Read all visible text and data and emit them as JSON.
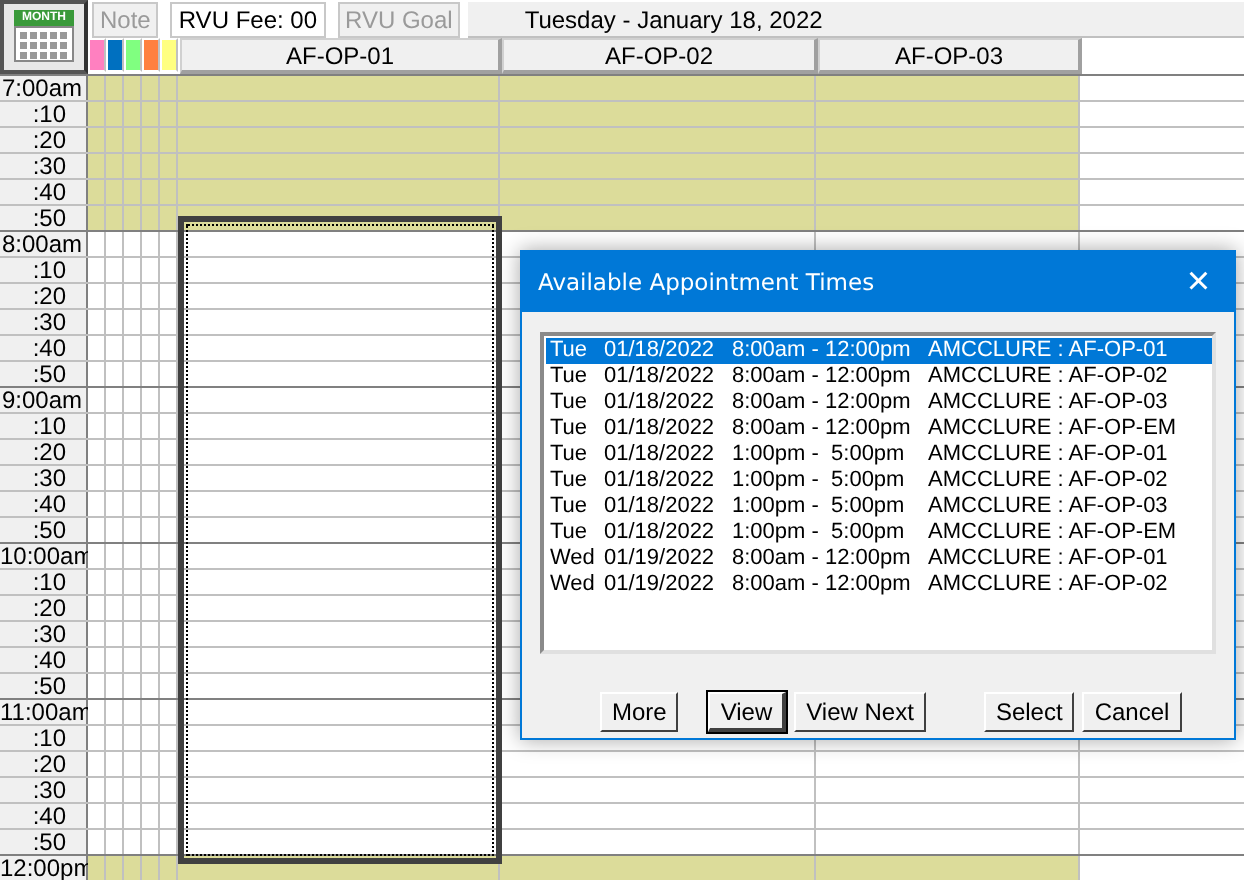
{
  "toolbar": {
    "month_button": "MONTH",
    "tabs": [
      {
        "label": "Note",
        "disabled": true
      },
      {
        "label": "RVU Fee: 00",
        "disabled": false
      },
      {
        "label": "RVU Goal",
        "disabled": true
      }
    ],
    "date_title": "Tuesday - January 18, 2022"
  },
  "swatches": [
    {
      "color": "#ff80c0"
    },
    {
      "color": "#0070c0"
    },
    {
      "color": "#80ff80"
    },
    {
      "color": "#ff8040"
    },
    {
      "color": "#ffff80"
    }
  ],
  "columns": [
    "AF-OP-01",
    "AF-OP-02",
    "AF-OP-03"
  ],
  "hours": [
    {
      "label": "7:00am",
      "highlighted": true,
      "minutes": [
        ":10",
        ":20",
        ":30",
        ":40",
        ":50"
      ]
    },
    {
      "label": "8:00am",
      "highlighted": false,
      "minutes": [
        ":10",
        ":20",
        ":30",
        ":40",
        ":50"
      ]
    },
    {
      "label": "9:00am",
      "highlighted": false,
      "minutes": [
        ":10",
        ":20",
        ":30",
        ":40",
        ":50"
      ]
    },
    {
      "label": "10:00am",
      "highlighted": false,
      "minutes": [
        ":10",
        ":20",
        ":30",
        ":40",
        ":50"
      ]
    },
    {
      "label": "11:00am",
      "highlighted": false,
      "minutes": [
        ":10",
        ":20",
        ":30",
        ":40",
        ":50"
      ]
    },
    {
      "label": "12:00pm",
      "highlighted": true
    }
  ],
  "dialog": {
    "title": "Available Appointment Times",
    "close": "×",
    "items": [
      {
        "day": "Tue",
        "date": "01/18/2022",
        "time": "8:00am - 12:00pm",
        "resource": "AMCCLURE : AF-OP-01",
        "selected": true
      },
      {
        "day": "Tue",
        "date": "01/18/2022",
        "time": "8:00am - 12:00pm",
        "resource": "AMCCLURE : AF-OP-02",
        "selected": false
      },
      {
        "day": "Tue",
        "date": "01/18/2022",
        "time": "8:00am - 12:00pm",
        "resource": "AMCCLURE : AF-OP-03",
        "selected": false
      },
      {
        "day": "Tue",
        "date": "01/18/2022",
        "time": "8:00am - 12:00pm",
        "resource": "AMCCLURE : AF-OP-EM",
        "selected": false
      },
      {
        "day": "Tue",
        "date": "01/18/2022",
        "time": "1:00pm -  5:00pm",
        "resource": "AMCCLURE : AF-OP-01",
        "selected": false
      },
      {
        "day": "Tue",
        "date": "01/18/2022",
        "time": "1:00pm -  5:00pm",
        "resource": "AMCCLURE : AF-OP-02",
        "selected": false
      },
      {
        "day": "Tue",
        "date": "01/18/2022",
        "time": "1:00pm -  5:00pm",
        "resource": "AMCCLURE : AF-OP-03",
        "selected": false
      },
      {
        "day": "Tue",
        "date": "01/18/2022",
        "time": "1:00pm -  5:00pm",
        "resource": "AMCCLURE : AF-OP-EM",
        "selected": false
      },
      {
        "day": "Wed",
        "date": "01/19/2022",
        "time": "8:00am - 12:00pm",
        "resource": "AMCCLURE : AF-OP-01",
        "selected": false
      },
      {
        "day": "Wed",
        "date": "01/19/2022",
        "time": "8:00am - 12:00pm",
        "resource": "AMCCLURE : AF-OP-02",
        "selected": false
      }
    ],
    "buttons": [
      {
        "label": "More",
        "default": false
      },
      {
        "label": "View",
        "default": true
      },
      {
        "label": "View Next",
        "default": false
      },
      {
        "label": "Select",
        "default": false
      },
      {
        "label": "Cancel",
        "default": false
      }
    ]
  }
}
